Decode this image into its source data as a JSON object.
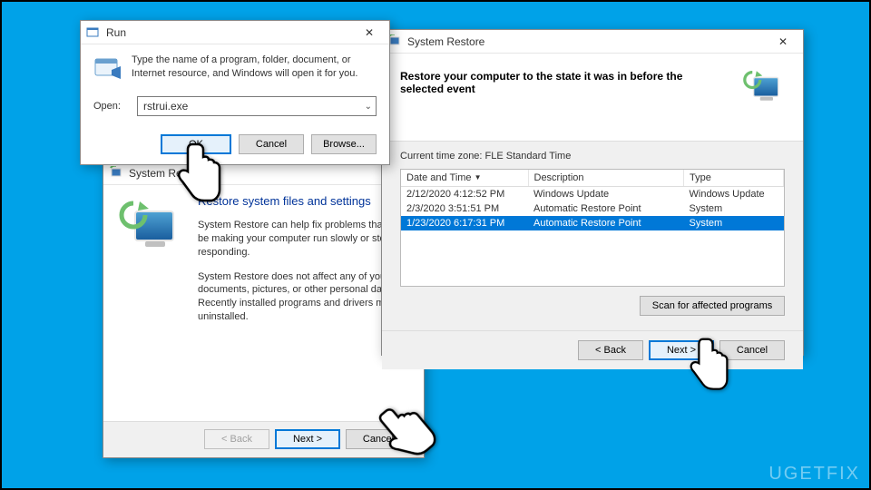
{
  "run": {
    "title": "Run",
    "description": "Type the name of a program, folder, document, or Internet resource, and Windows will open it for you.",
    "open_label": "Open:",
    "value": "rstrui.exe",
    "ok": "OK",
    "cancel": "Cancel",
    "browse": "Browse..."
  },
  "wizard": {
    "title": "System Restore",
    "heading": "Restore system files and settings",
    "p1": "System Restore can help fix problems that might be making your computer run slowly or stop responding.",
    "p2": "System Restore does not affect any of your documents, pictures, or other personal data. Recently installed programs and drivers might be uninstalled.",
    "back": "< Back",
    "next": "Next >",
    "cancel": "Cancel"
  },
  "points": {
    "title": "System Restore",
    "heading": "Restore your computer to the state it was in before the selected event",
    "timezone": "Current time zone: FLE Standard Time",
    "cols": {
      "date": "Date and Time",
      "desc": "Description",
      "type": "Type"
    },
    "rows": [
      {
        "date": "2/12/2020 4:12:52 PM",
        "desc": "Windows Update",
        "type": "Windows Update",
        "selected": false
      },
      {
        "date": "2/3/2020 3:51:51 PM",
        "desc": "Automatic Restore Point",
        "type": "System",
        "selected": false
      },
      {
        "date": "1/23/2020 6:17:31 PM",
        "desc": "Automatic Restore Point",
        "type": "System",
        "selected": true
      }
    ],
    "scan": "Scan for affected programs",
    "back": "< Back",
    "next": "Next >",
    "cancel": "Cancel"
  },
  "watermark": "UGETFIX"
}
